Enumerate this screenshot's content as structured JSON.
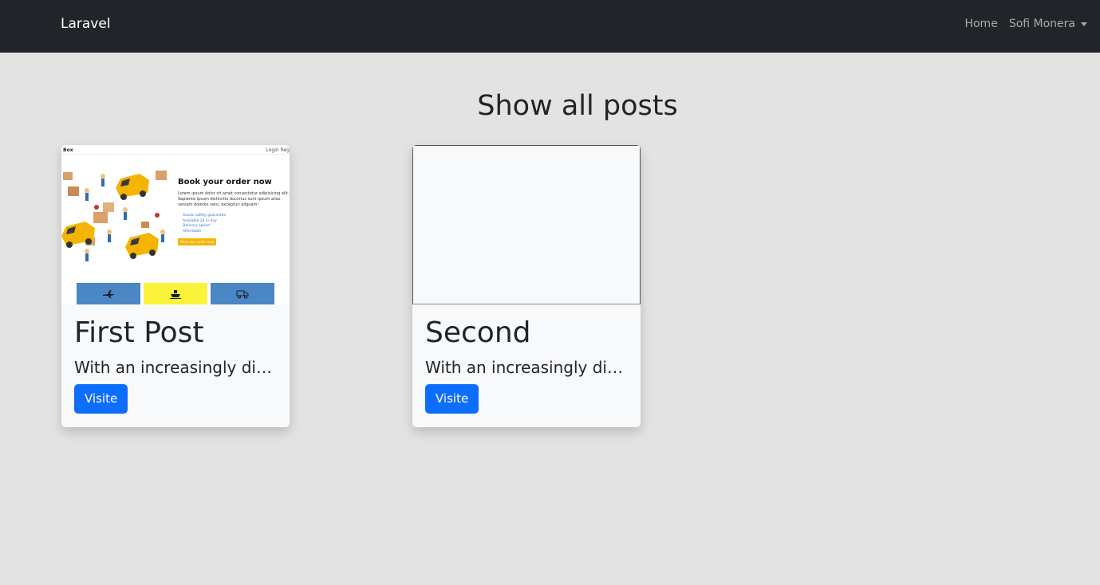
{
  "navbar": {
    "brand": "Laravel",
    "links": {
      "home": "Home",
      "user": "Sofi Monera"
    }
  },
  "page": {
    "title": "Show all posts"
  },
  "posts": [
    {
      "title": "First Post",
      "excerpt": "With an increasingly digital world",
      "button": "Visite",
      "thumbnail": {
        "brand": "Box",
        "nav": "Login  Reg",
        "heading": "Book your order now",
        "paragraph": "Lorem ipsum dolor sit amet consectetur adipisicing elit. Sapiente ipsum distinctio ducimus sunt ipsum alias veniam dolores vero, excepturi aliquam!",
        "features": [
          "Goods safety guarantee",
          "Available 24 in day",
          "Delivery speed",
          "Affordable"
        ],
        "cta": "Book your order now",
        "tiles": [
          "airplane-icon",
          "ship-icon",
          "truck-icon"
        ]
      }
    },
    {
      "title": "Second",
      "excerpt": "With an increasingly digital world",
      "button": "Visite"
    }
  ],
  "colors": {
    "navbar": "#212529",
    "background": "#e3e3e3",
    "primary": "#0d6efd",
    "card": "#f8f9fa",
    "tile_blue": "#4b86c5",
    "tile_yellow": "#fbf33a",
    "van": "#f5b400"
  }
}
